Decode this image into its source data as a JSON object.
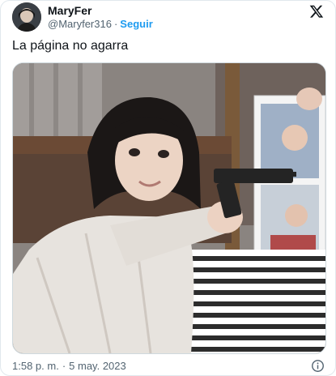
{
  "tweet": {
    "author": {
      "display_name": "MaryFer",
      "handle": "@Maryfer316",
      "separator": "·",
      "follow_label": "Seguir"
    },
    "text": "La página no agarra",
    "timestamp": {
      "time": "1:58 p. m.",
      "separator": "·",
      "date": "5 may. 2023"
    },
    "icons": {
      "logo": "x-logo-icon",
      "info": "info-icon"
    }
  },
  "colors": {
    "accent": "#1d9bf0",
    "text_primary": "#0f1419",
    "text_secondary": "#536471",
    "border": "#e1e8ed"
  }
}
